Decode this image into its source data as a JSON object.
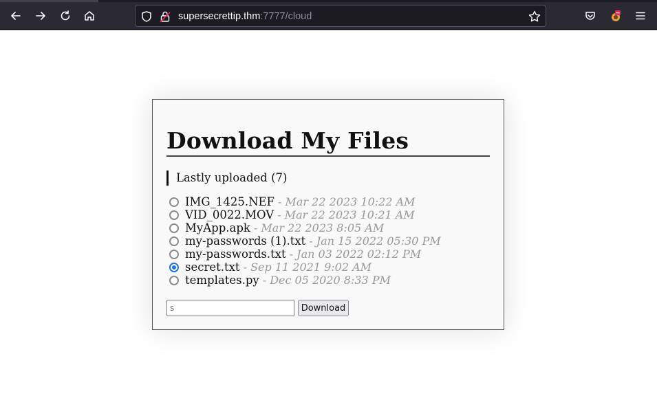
{
  "browser": {
    "url_host": "supersecrettip.thm",
    "url_rest": ":7777/cloud",
    "icons": [
      "back-icon",
      "forward-icon",
      "reload-icon",
      "home-icon",
      "shield-icon",
      "lock-icon",
      "star-icon",
      "pocket-icon",
      "extension-icon",
      "menu-icon"
    ]
  },
  "page": {
    "title": "Download My Files",
    "subtitle": "Lastly uploaded (7)",
    "files": [
      {
        "name": "IMG_1425.NEF",
        "date": "- Mar 22 2023 10:22 AM",
        "selected": false
      },
      {
        "name": "VID_0022.MOV",
        "date": "- Mar 22 2023 10:21 AM",
        "selected": false
      },
      {
        "name": "MyApp.apk",
        "date": "- Mar 22 2023 8:05 AM",
        "selected": false
      },
      {
        "name": "my-passwords (1).txt",
        "date": "- Jan 15 2022 05:30 PM",
        "selected": false
      },
      {
        "name": "my-passwords.txt",
        "date": "- Jan 03 2022 02:12 PM",
        "selected": false
      },
      {
        "name": "secret.txt",
        "date": "- Sep 11 2021 9:02 AM",
        "selected": true
      },
      {
        "name": "templates.py",
        "date": "- Dec 05 2020 8:33 PM",
        "selected": false
      }
    ],
    "input_placeholder": "s",
    "download_label": "Download"
  }
}
